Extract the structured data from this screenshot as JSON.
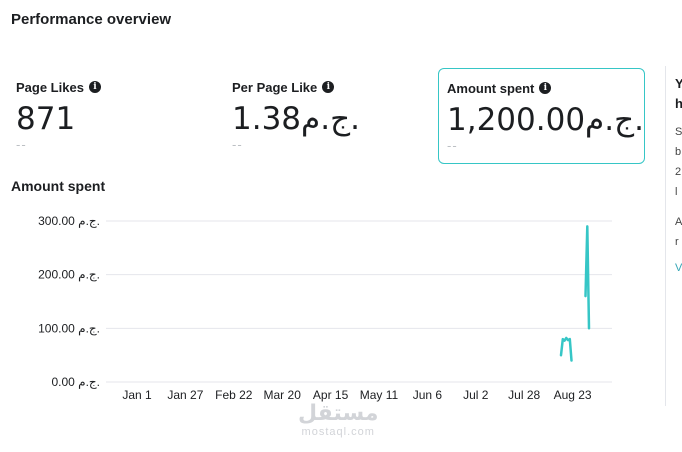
{
  "header": {
    "title": "Performance overview"
  },
  "cards": [
    {
      "label": "Page Likes",
      "value": "871",
      "delta": "--"
    },
    {
      "label": "Per Page Like",
      "value": "1.38ج.م.",
      "delta": "--"
    },
    {
      "label": "Amount spent",
      "value": "1,200.00ج.م.",
      "delta": "--",
      "selected": true
    }
  ],
  "chart_title": "Amount spent",
  "chart_data": {
    "type": "line",
    "title": "Amount spent",
    "xlabel": "",
    "ylabel": "",
    "ylim": [
      0,
      300
    ],
    "yticks": [
      {
        "value": 300,
        "label": "300.00 ج.م."
      },
      {
        "value": 200,
        "label": "200.00 ج.م."
      },
      {
        "value": 100,
        "label": "100.00 ج.م."
      },
      {
        "value": 0,
        "label": "0.00 ج.م."
      }
    ],
    "xticks": [
      "Jan 1",
      "Jan 27",
      "Feb 22",
      "Mar 20",
      "Apr 15",
      "May 11",
      "Jun 6",
      "Jul 2",
      "Jul 28",
      "Aug 23"
    ],
    "series": [
      {
        "color": "#36c6c6",
        "segments": [
          [
            [
              0,
              50
            ],
            [
              1,
              80
            ],
            [
              2,
              77
            ],
            [
              3,
              82
            ],
            [
              4,
              78
            ],
            [
              5,
              80
            ],
            [
              6,
              40
            ]
          ],
          [
            [
              14,
              160
            ],
            [
              15,
              290
            ],
            [
              16,
              100
            ]
          ]
        ]
      }
    ],
    "grid": true
  },
  "side_fragments": [
    {
      "text": "Y",
      "tone": "dark"
    },
    {
      "text": "h",
      "tone": "dark"
    },
    {
      "text": "S",
      "tone": "muted"
    },
    {
      "text": "b",
      "tone": "muted"
    },
    {
      "text": "2",
      "tone": "muted"
    },
    {
      "text": "l",
      "tone": "muted"
    },
    {
      "text": "A",
      "tone": "muted"
    },
    {
      "text": "r",
      "tone": "muted"
    },
    {
      "text": "V",
      "tone": "link"
    }
  ],
  "watermark": {
    "arabic": "مستقل",
    "latin": "mostaql.com"
  }
}
